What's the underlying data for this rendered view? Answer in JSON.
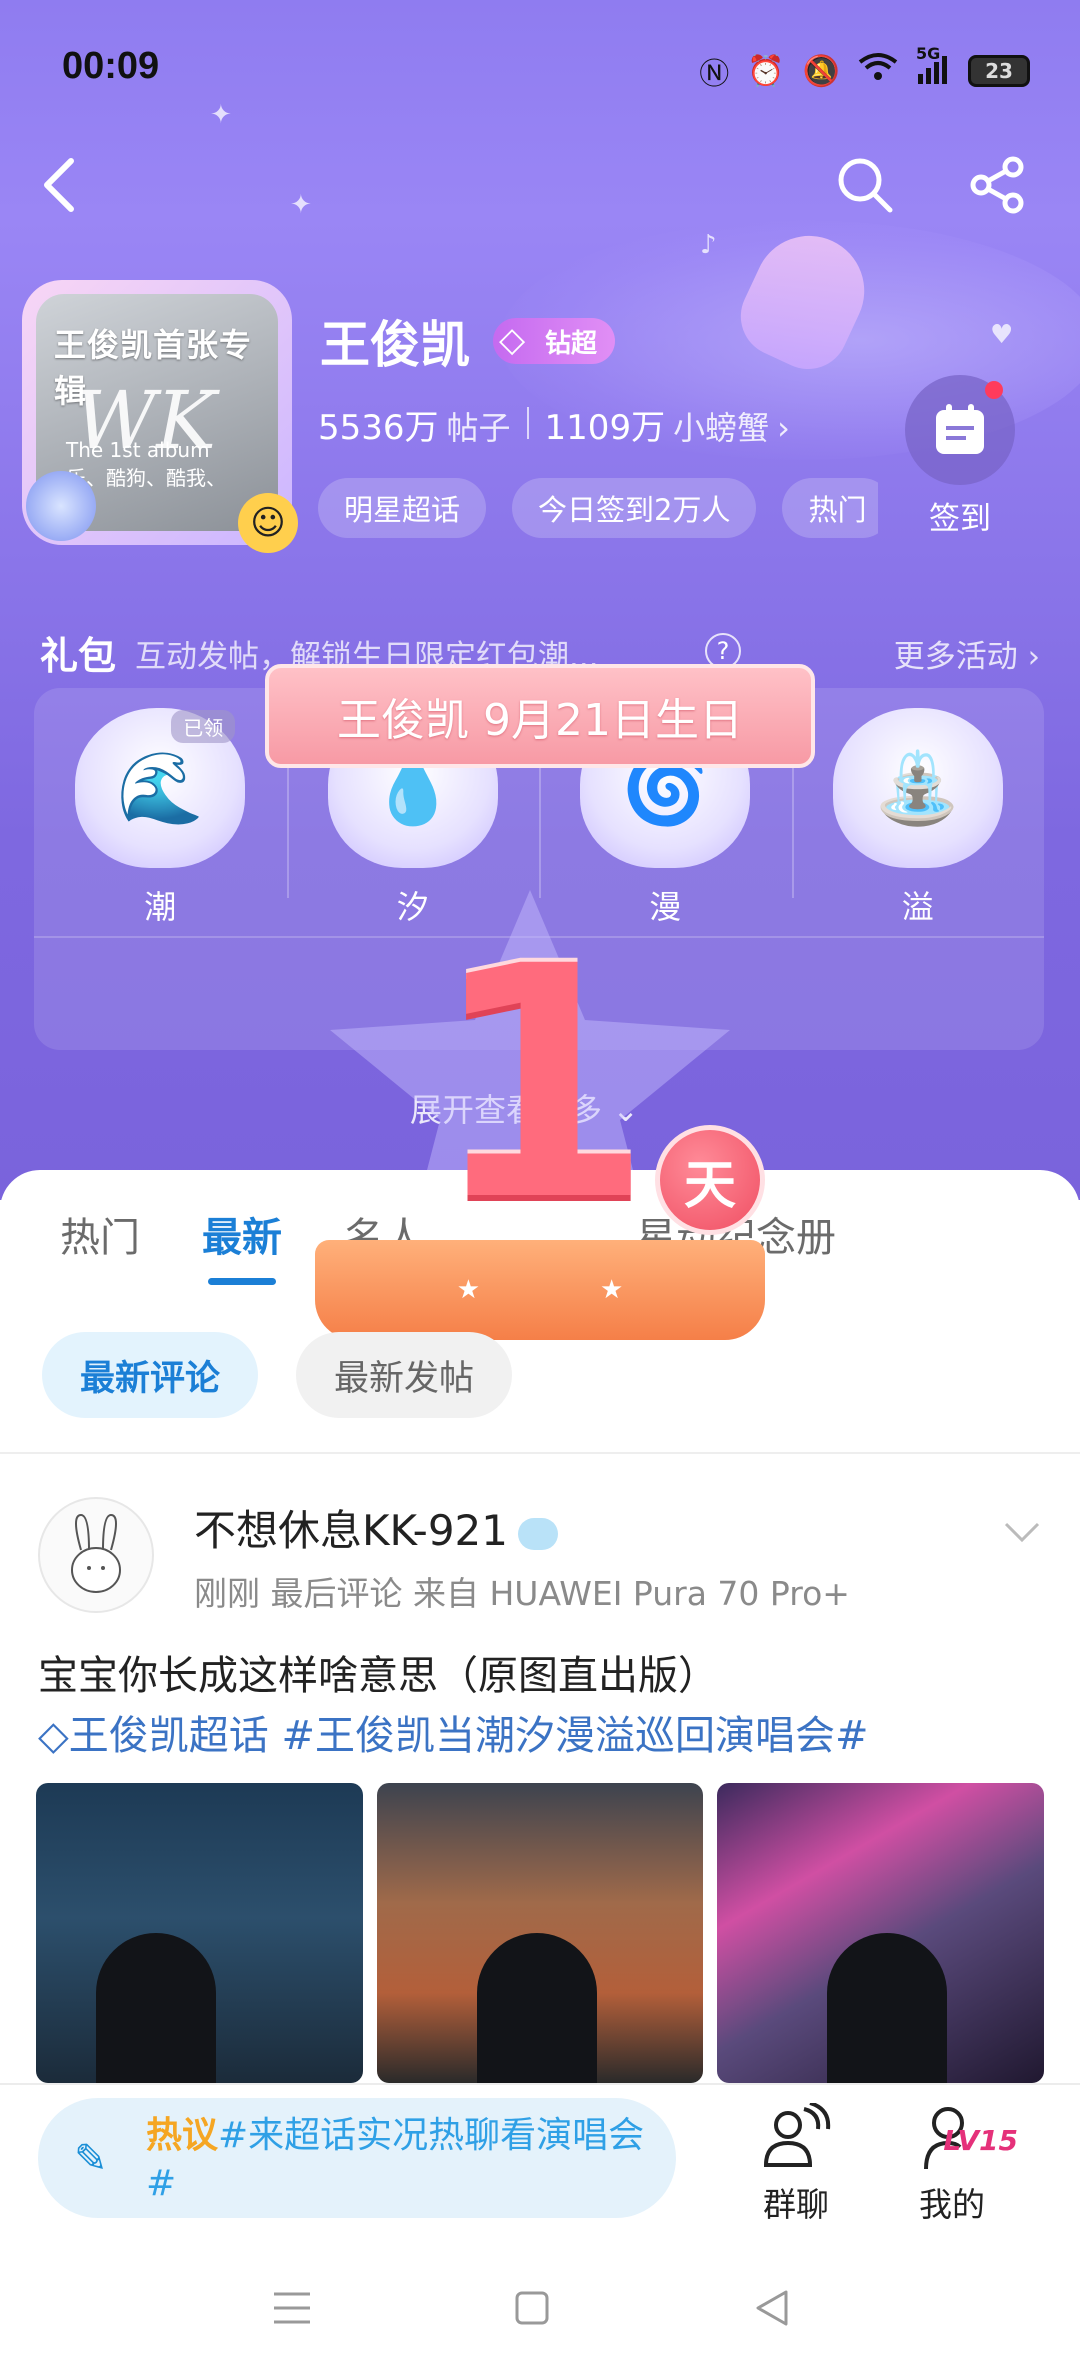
{
  "status_bar": {
    "time": "00:09",
    "battery": "23",
    "signal_label": "5G"
  },
  "topic": {
    "name": "王俊凯",
    "badge_label": "钻超",
    "posts_count": "5536万",
    "posts_unit": "帖子",
    "fans_count": "1109万",
    "fans_unit": "小螃蟹",
    "album_title": "王俊凯首张专辑",
    "album_letters": "WK",
    "album_sub": "The 1st album",
    "album_tags": "乐、酷狗、酷我、"
  },
  "chips": [
    {
      "label": "明星超话"
    },
    {
      "label": "今日签到2万人"
    },
    {
      "label": "热门"
    }
  ],
  "signin": {
    "label": "签到"
  },
  "gift": {
    "title": "礼包",
    "desc": "互动发帖，解锁生日限定红包潮...",
    "help": "?",
    "more": "更多活动 ›",
    "claimed_label": "已领",
    "items": [
      {
        "label": "潮",
        "icon": "wave-icon"
      },
      {
        "label": "汐",
        "icon": "tide-icon"
      },
      {
        "label": "漫",
        "icon": "swirl-icon"
      },
      {
        "label": "溢",
        "icon": "fountain-icon"
      }
    ],
    "expand": "展开查看更多"
  },
  "birthday": {
    "banner": "王俊凯 9月21日生日",
    "count": "1",
    "unit": "天"
  },
  "tabs": [
    {
      "label": "热门"
    },
    {
      "label": "最新"
    },
    {
      "label": "名人"
    },
    {
      "label": "星动纪念册"
    }
  ],
  "sub_tabs": [
    {
      "label": "最新评论"
    },
    {
      "label": "最新发帖"
    }
  ],
  "post": {
    "author": "不想休息KK-921",
    "meta": "刚刚 最后评论   来自 HUAWEI Pura 70 Pro+",
    "text": "宝宝你长成这样啥意思（原图直出版）",
    "tags": "王俊凯超话 #王俊凯当潮汐漫溢巡回演唱会#"
  },
  "bottom_bar": {
    "compose_hot": "热议",
    "compose_text": "#来超话实况热聊看演唱会#",
    "group_chat": "群聊",
    "mine": "我的",
    "level": "LV15"
  },
  "colors": {
    "accent": "#1b7fd6",
    "hero": "#8f7cf0",
    "birthday_pink": "#ff6b7d"
  }
}
